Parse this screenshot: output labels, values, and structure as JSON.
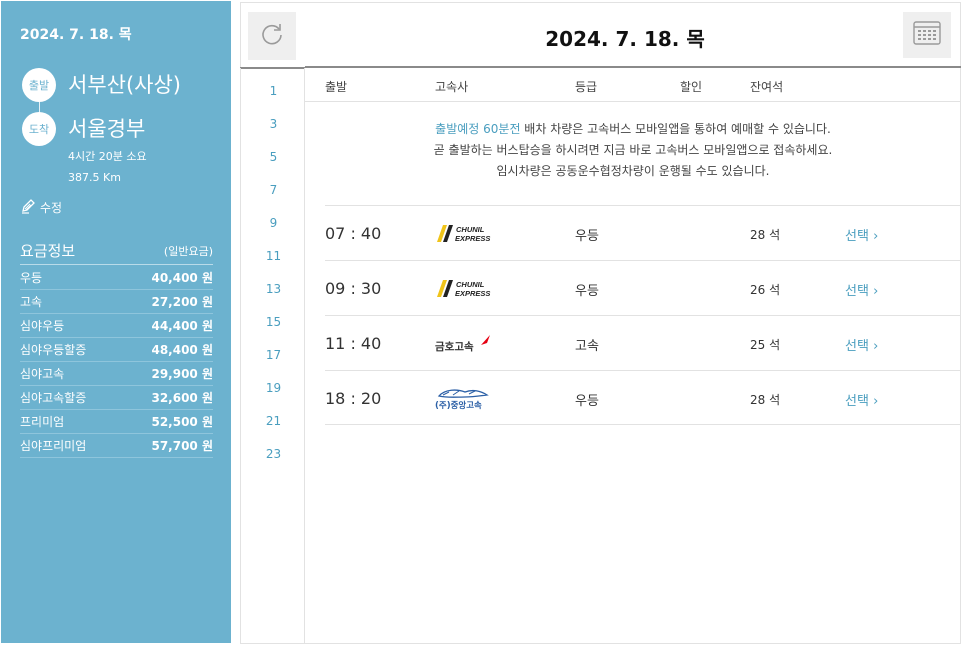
{
  "header": {
    "date": "2024. 7. 18. 목"
  },
  "route": {
    "date": "2024. 7. 18. 목",
    "departure_badge": "출발",
    "departure": "서부산(사상)",
    "arrival_badge": "도착",
    "arrival": "서울경부",
    "duration": "4시간 20분 소요",
    "distance": "387.5 Km",
    "edit_label": "수정"
  },
  "fares": {
    "title": "요금정보",
    "subtitle": "(일반요금)",
    "items": [
      {
        "grade": "우등",
        "amount": "40,400 원"
      },
      {
        "grade": "고속",
        "amount": "27,200 원"
      },
      {
        "grade": "심야우등",
        "amount": "44,400 원"
      },
      {
        "grade": "심야우등할증",
        "amount": "48,400 원"
      },
      {
        "grade": "심야고속",
        "amount": "29,900 원"
      },
      {
        "grade": "심야고속할증",
        "amount": "32,600 원"
      },
      {
        "grade": "프리미엄",
        "amount": "52,500 원"
      },
      {
        "grade": "심야프리미엄",
        "amount": "57,700 원"
      }
    ]
  },
  "hours": [
    "1",
    "3",
    "5",
    "7",
    "9",
    "11",
    "13",
    "15",
    "17",
    "19",
    "21",
    "23"
  ],
  "columns": {
    "departure": "출발",
    "company": "고속사",
    "grade": "등급",
    "discount": "할인",
    "seats": "잔여석"
  },
  "notice": {
    "highlight": "출발예정 60분전",
    "line1_rest": " 배차 차량은 고속버스 모바일앱을 통하여 예매할 수 있습니다.",
    "line2": "곧 출발하는 버스탑승을 하시려면 지금 바로 고속버스 모바일앱으로 접속하세요.",
    "line3": "임시차량은 공동운수협정차량이 운행될 수도 있습니다."
  },
  "schedules": [
    {
      "time": "07 : 40",
      "company": "CHUNIL EXPRESS",
      "logo": "chunil-logo",
      "grade": "우등",
      "seats": "28 석",
      "select": "선택"
    },
    {
      "time": "09 : 30",
      "company": "CHUNIL EXPRESS",
      "logo": "chunil-logo",
      "grade": "우등",
      "seats": "26 석",
      "select": "선택"
    },
    {
      "time": "11 : 40",
      "company": "금호고속",
      "logo": "kumho-logo",
      "grade": "고속",
      "seats": "25 석",
      "select": "선택"
    },
    {
      "time": "18 : 20",
      "company": "(주)중앙고속",
      "logo": "jungang-logo",
      "grade": "우등",
      "seats": "28 석",
      "select": "선택"
    }
  ],
  "colors": {
    "sidebar": "#6cb2cf",
    "accent": "#4a9ebf",
    "kumho_red": "#e60012",
    "chunil_yellow": "#f0c419"
  }
}
